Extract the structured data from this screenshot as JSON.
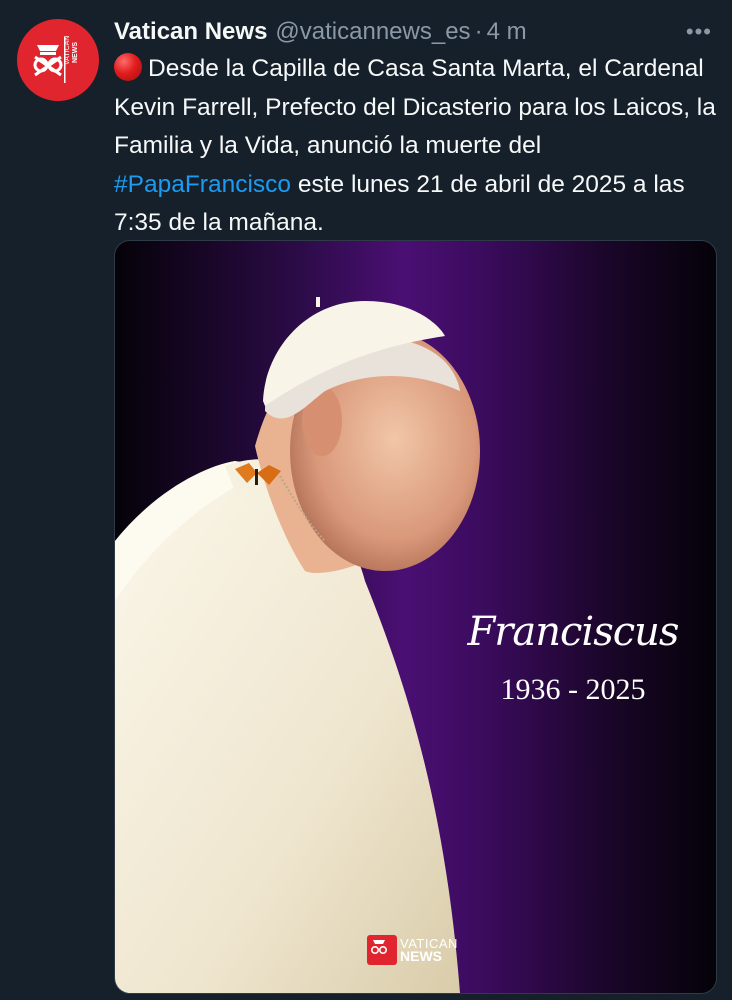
{
  "tweet": {
    "author_name": "Vatican News",
    "handle": "@vaticannews_es",
    "separator": "·",
    "time": "4 m",
    "more_label": "•••",
    "avatar_text": "VATICAN NEWS",
    "text_before": "Desde la Capilla de Casa Santa Marta, el Cardenal Kevin Farrell, Prefecto del Dicasterio para los Laicos, la Familia y la Vida, anunció la muerte del ",
    "hashtag": "#PapaFrancisco",
    "text_after": " este lunes 21 de abril de 2025 a las 7:35 de la mañana."
  },
  "media": {
    "signature": "Franciscus",
    "years": "1936 - 2025",
    "watermark_top": "VATICAN",
    "watermark_bottom": "NEWS"
  },
  "colors": {
    "background": "#15202b",
    "brand_red": "#e1252f",
    "link": "#1d9bf0",
    "muted": "#8b98a5",
    "purple": "#4a0f73"
  },
  "icons": [
    "vatican-news-logo-icon",
    "red-circle-emoji-icon",
    "more-options-icon"
  ]
}
